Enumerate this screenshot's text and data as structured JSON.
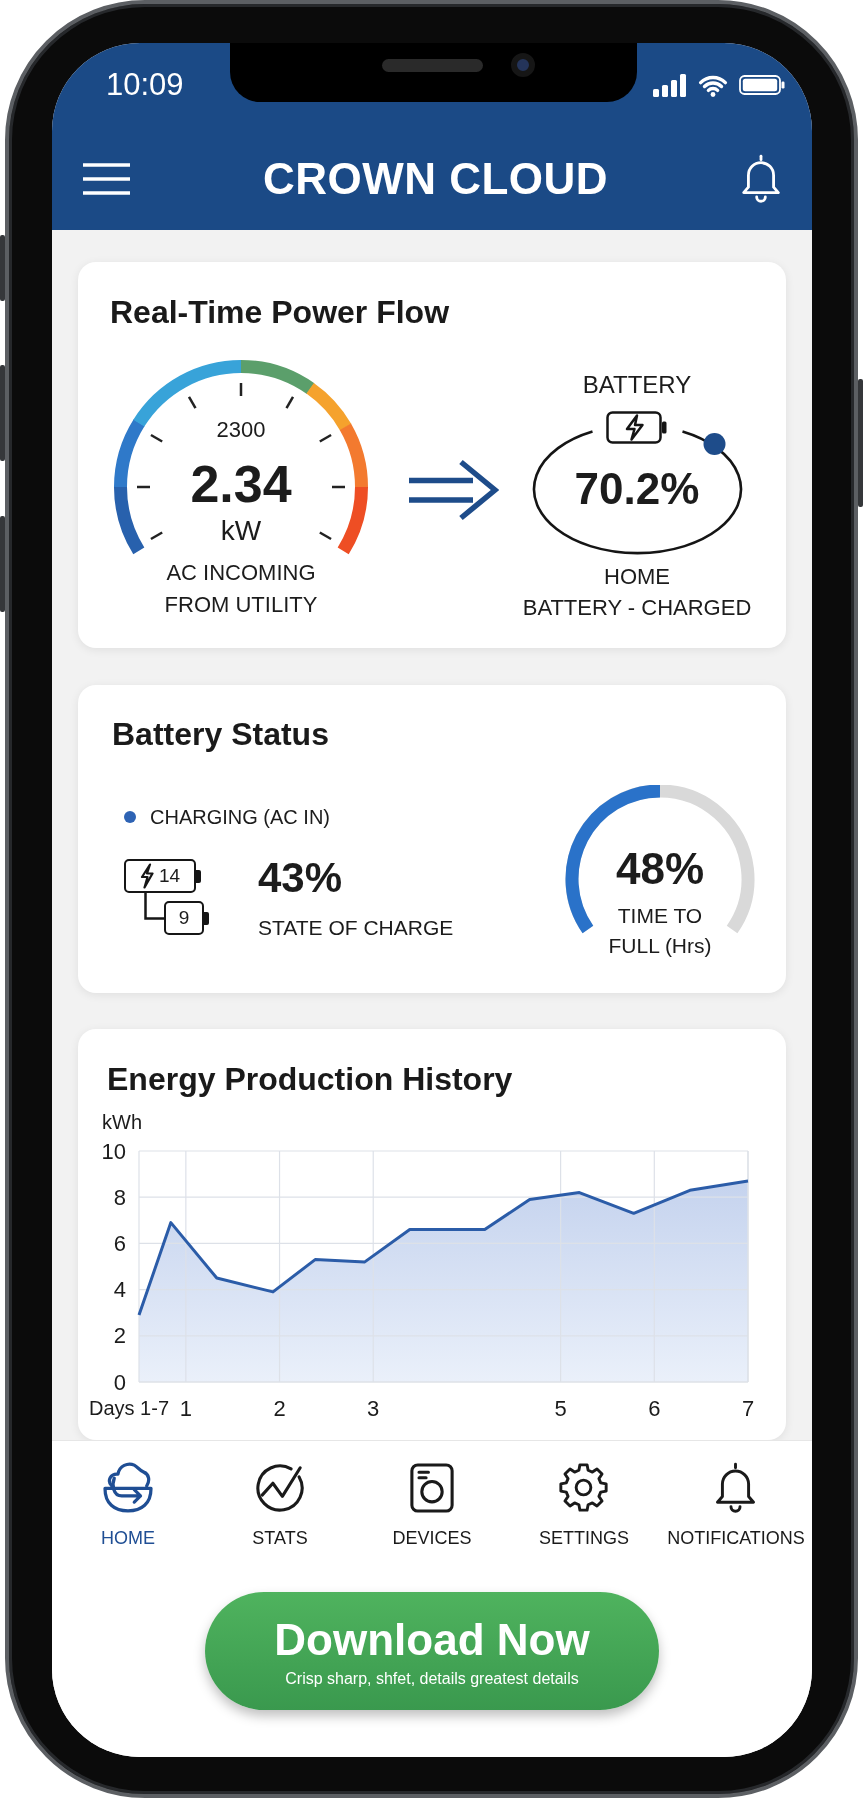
{
  "status_bar": {
    "time": "10:09"
  },
  "header": {
    "title": "CROWN CLOUD"
  },
  "power_flow": {
    "title": "Real-Time Power Flow",
    "gauge": {
      "scale_label": "2300",
      "value": "2.34",
      "unit": "kW",
      "caption": "AC INCOMING\nFROM UTILITY"
    },
    "battery": {
      "label": "BATTERY",
      "value": "70.2%",
      "caption": "HOME\nBATTERY - CHARGED"
    }
  },
  "battery_status": {
    "title": "Battery Status",
    "status": "CHARGING (AC IN)",
    "cells": [
      "14",
      "9"
    ],
    "charge": "43%",
    "charge_label": "STATE OF CHARGE",
    "time_to_full": {
      "level": 0.5,
      "value": "48%",
      "label": "TIME TO\nFULL (Hrs)"
    }
  },
  "energy_history": {
    "title": "Energy Production History",
    "chart_data": {
      "type": "area",
      "xlabel": "Days 1-7",
      "ylabel": "kWh",
      "x": [
        0.5,
        0.84,
        1.33,
        1.93,
        2.38,
        2.91,
        3.39,
        4.19,
        4.67,
        5.2,
        5.78,
        6.38,
        7.0
      ],
      "values": [
        2.9,
        6.9,
        4.5,
        3.9,
        5.3,
        5.2,
        6.6,
        6.6,
        7.9,
        8.2,
        7.3,
        8.3,
        8.7
      ],
      "xlim": [
        0.5,
        7
      ],
      "ylim": [
        0,
        10
      ],
      "xticks": [
        1,
        2,
        3,
        5,
        6,
        7
      ],
      "yticks": [
        0,
        2,
        4,
        6,
        8,
        10
      ],
      "grid": true
    }
  },
  "nav": [
    {
      "label": "HOME",
      "kind": "home",
      "selected": true
    },
    {
      "label": "STATS",
      "kind": "stats",
      "selected": false
    },
    {
      "label": "DEVICES",
      "kind": "devices",
      "selected": false
    },
    {
      "label": "SETTINGS",
      "kind": "settings",
      "selected": false
    },
    {
      "label": "NOTIFICATIONS",
      "kind": "notifications",
      "selected": false
    }
  ],
  "download": {
    "label": "Download Now",
    "caption": "Crisp sharp, shfet, details greatest details"
  }
}
